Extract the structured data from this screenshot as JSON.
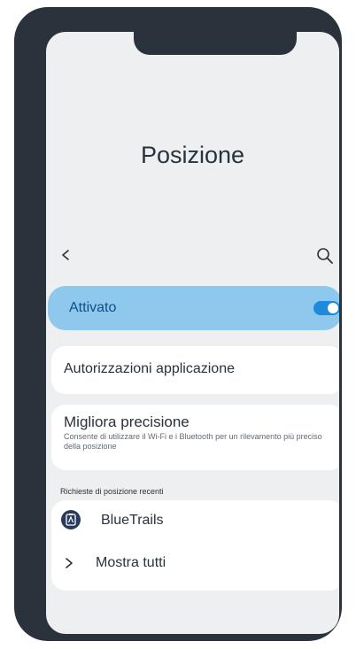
{
  "screen": {
    "title": "Posizione",
    "back_icon": "chevron-left-icon",
    "search_icon": "search-icon"
  },
  "location_toggle": {
    "label": "Attivato",
    "state": "on",
    "accent_color": "#8ec8ec",
    "switch_color": "#1f89dc"
  },
  "permissions": {
    "label": "Autorizzazioni applicazione"
  },
  "precision": {
    "title": "Migliora precisione",
    "description": "Consente di utilizzare il Wi-Fi e i Bluetooth per un rilevamento più preciso della posizione"
  },
  "recent_requests": {
    "header": "Richieste di posizione recenti",
    "apps": [
      {
        "name": "BlueTrails",
        "icon": "app-icon"
      }
    ],
    "show_all_label": "Mostra tutti"
  }
}
